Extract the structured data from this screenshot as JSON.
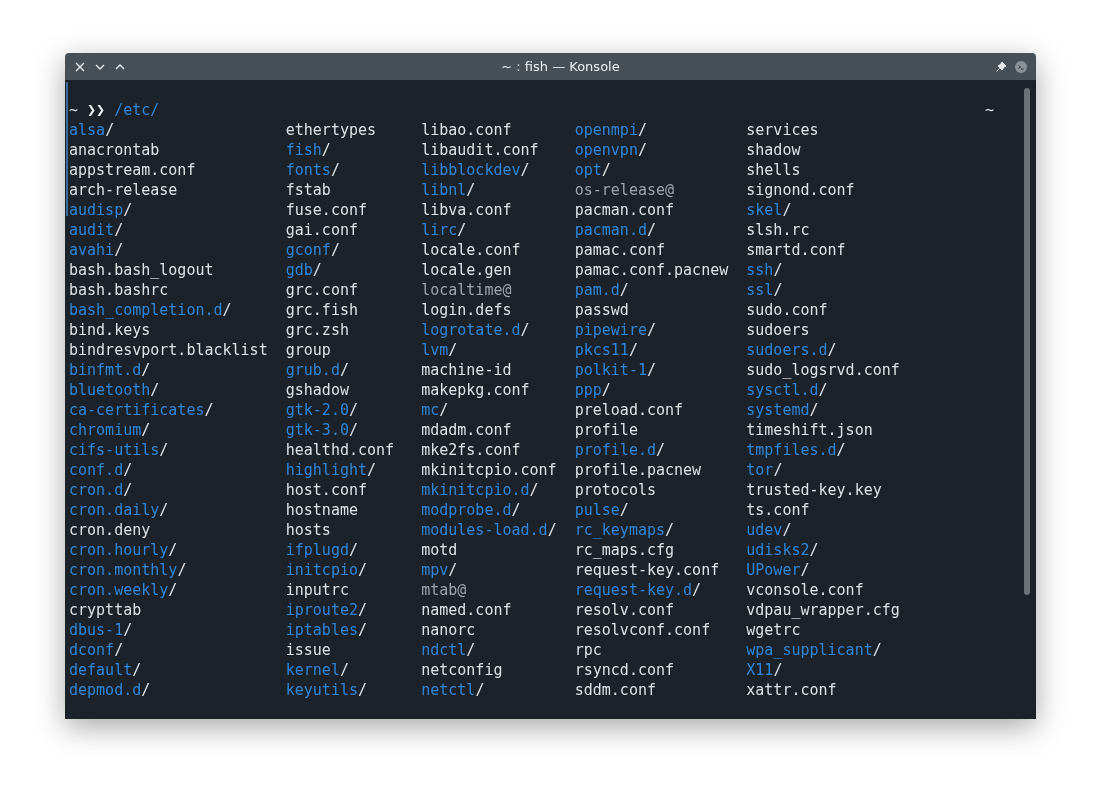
{
  "window": {
    "title": "~ : fish — Konsole"
  },
  "prompt": {
    "cwd": "~",
    "arrows": "❯❯",
    "command": "/etc/",
    "right_prompt": "~"
  },
  "columns": [
    [
      {
        "name": "alsa",
        "suffix": "/",
        "kind": "dir"
      },
      {
        "name": "anacrontab",
        "kind": "file"
      },
      {
        "name": "appstream.conf",
        "kind": "file"
      },
      {
        "name": "arch-release",
        "kind": "file"
      },
      {
        "name": "audisp",
        "suffix": "/",
        "kind": "dir"
      },
      {
        "name": "audit",
        "suffix": "/",
        "kind": "dir"
      },
      {
        "name": "avahi",
        "suffix": "/",
        "kind": "dir"
      },
      {
        "name": "bash.bash_logout",
        "kind": "file"
      },
      {
        "name": "bash.bashrc",
        "kind": "file"
      },
      {
        "name": "bash_completion.d",
        "suffix": "/",
        "kind": "dir"
      },
      {
        "name": "bind.keys",
        "kind": "file"
      },
      {
        "name": "bindresvport.blacklist",
        "kind": "file"
      },
      {
        "name": "binfmt.d",
        "suffix": "/",
        "kind": "dir"
      },
      {
        "name": "bluetooth",
        "suffix": "/",
        "kind": "dir"
      },
      {
        "name": "ca-certificates",
        "suffix": "/",
        "kind": "dir"
      },
      {
        "name": "chromium",
        "suffix": "/",
        "kind": "dir"
      },
      {
        "name": "cifs-utils",
        "suffix": "/",
        "kind": "dir"
      },
      {
        "name": "conf.d",
        "suffix": "/",
        "kind": "dir"
      },
      {
        "name": "cron.d",
        "suffix": "/",
        "kind": "dir"
      },
      {
        "name": "cron.daily",
        "suffix": "/",
        "kind": "dir"
      },
      {
        "name": "cron.deny",
        "kind": "file"
      },
      {
        "name": "cron.hourly",
        "suffix": "/",
        "kind": "dir"
      },
      {
        "name": "cron.monthly",
        "suffix": "/",
        "kind": "dir"
      },
      {
        "name": "cron.weekly",
        "suffix": "/",
        "kind": "dir"
      },
      {
        "name": "crypttab",
        "kind": "file"
      },
      {
        "name": "dbus-1",
        "suffix": "/",
        "kind": "dir"
      },
      {
        "name": "dconf",
        "suffix": "/",
        "kind": "dir"
      },
      {
        "name": "default",
        "suffix": "/",
        "kind": "dir"
      },
      {
        "name": "depmod.d",
        "suffix": "/",
        "kind": "dir"
      }
    ],
    [
      {
        "name": "ethertypes",
        "kind": "file"
      },
      {
        "name": "fish",
        "suffix": "/",
        "kind": "dir"
      },
      {
        "name": "fonts",
        "suffix": "/",
        "kind": "dir"
      },
      {
        "name": "fstab",
        "kind": "file"
      },
      {
        "name": "fuse.conf",
        "kind": "file"
      },
      {
        "name": "gai.conf",
        "kind": "file"
      },
      {
        "name": "gconf",
        "suffix": "/",
        "kind": "dir"
      },
      {
        "name": "gdb",
        "suffix": "/",
        "kind": "dir"
      },
      {
        "name": "grc.conf",
        "kind": "file"
      },
      {
        "name": "grc.fish",
        "kind": "file"
      },
      {
        "name": "grc.zsh",
        "kind": "file"
      },
      {
        "name": "group",
        "kind": "file"
      },
      {
        "name": "grub.d",
        "suffix": "/",
        "kind": "dir"
      },
      {
        "name": "gshadow",
        "kind": "file"
      },
      {
        "name": "gtk-2.0",
        "suffix": "/",
        "kind": "dir"
      },
      {
        "name": "gtk-3.0",
        "suffix": "/",
        "kind": "dir"
      },
      {
        "name": "healthd.conf",
        "kind": "file"
      },
      {
        "name": "highlight",
        "suffix": "/",
        "kind": "dir"
      },
      {
        "name": "host.conf",
        "kind": "file"
      },
      {
        "name": "hostname",
        "kind": "file"
      },
      {
        "name": "hosts",
        "kind": "file"
      },
      {
        "name": "ifplugd",
        "suffix": "/",
        "kind": "dir"
      },
      {
        "name": "initcpio",
        "suffix": "/",
        "kind": "dir"
      },
      {
        "name": "inputrc",
        "kind": "file"
      },
      {
        "name": "iproute2",
        "suffix": "/",
        "kind": "dir"
      },
      {
        "name": "iptables",
        "suffix": "/",
        "kind": "dir"
      },
      {
        "name": "issue",
        "kind": "file"
      },
      {
        "name": "kernel",
        "suffix": "/",
        "kind": "dir"
      },
      {
        "name": "keyutils",
        "suffix": "/",
        "kind": "dir"
      }
    ],
    [
      {
        "name": "libao.conf",
        "kind": "file"
      },
      {
        "name": "libaudit.conf",
        "kind": "file"
      },
      {
        "name": "libblockdev",
        "suffix": "/",
        "kind": "dir"
      },
      {
        "name": "libnl",
        "suffix": "/",
        "kind": "dir"
      },
      {
        "name": "libva.conf",
        "kind": "file"
      },
      {
        "name": "lirc",
        "suffix": "/",
        "kind": "dir"
      },
      {
        "name": "locale.conf",
        "kind": "file"
      },
      {
        "name": "locale.gen",
        "kind": "file"
      },
      {
        "name": "localtime",
        "suffix": "@",
        "kind": "link"
      },
      {
        "name": "login.defs",
        "kind": "file"
      },
      {
        "name": "logrotate.d",
        "suffix": "/",
        "kind": "dir"
      },
      {
        "name": "lvm",
        "suffix": "/",
        "kind": "dir"
      },
      {
        "name": "machine-id",
        "kind": "file"
      },
      {
        "name": "makepkg.conf",
        "kind": "file"
      },
      {
        "name": "mc",
        "suffix": "/",
        "kind": "dir"
      },
      {
        "name": "mdadm.conf",
        "kind": "file"
      },
      {
        "name": "mke2fs.conf",
        "kind": "file"
      },
      {
        "name": "mkinitcpio.conf",
        "kind": "file"
      },
      {
        "name": "mkinitcpio.d",
        "suffix": "/",
        "kind": "dir"
      },
      {
        "name": "modprobe.d",
        "suffix": "/",
        "kind": "dir"
      },
      {
        "name": "modules-load.d",
        "suffix": "/",
        "kind": "dir"
      },
      {
        "name": "motd",
        "kind": "file"
      },
      {
        "name": "mpv",
        "suffix": "/",
        "kind": "dir"
      },
      {
        "name": "mtab",
        "suffix": "@",
        "kind": "link"
      },
      {
        "name": "named.conf",
        "kind": "file"
      },
      {
        "name": "nanorc",
        "kind": "file"
      },
      {
        "name": "ndctl",
        "suffix": "/",
        "kind": "dir"
      },
      {
        "name": "netconfig",
        "kind": "file"
      },
      {
        "name": "netctl",
        "suffix": "/",
        "kind": "dir"
      }
    ],
    [
      {
        "name": "openmpi",
        "suffix": "/",
        "kind": "dir"
      },
      {
        "name": "openvpn",
        "suffix": "/",
        "kind": "dir"
      },
      {
        "name": "opt",
        "suffix": "/",
        "kind": "dir"
      },
      {
        "name": "os-release",
        "suffix": "@",
        "kind": "link"
      },
      {
        "name": "pacman.conf",
        "kind": "file"
      },
      {
        "name": "pacman.d",
        "suffix": "/",
        "kind": "dir"
      },
      {
        "name": "pamac.conf",
        "kind": "file"
      },
      {
        "name": "pamac.conf.pacnew",
        "kind": "file"
      },
      {
        "name": "pam.d",
        "suffix": "/",
        "kind": "dir"
      },
      {
        "name": "passwd",
        "kind": "file"
      },
      {
        "name": "pipewire",
        "suffix": "/",
        "kind": "dir"
      },
      {
        "name": "pkcs11",
        "suffix": "/",
        "kind": "dir"
      },
      {
        "name": "polkit-1",
        "suffix": "/",
        "kind": "dir"
      },
      {
        "name": "ppp",
        "suffix": "/",
        "kind": "dir"
      },
      {
        "name": "preload.conf",
        "kind": "file"
      },
      {
        "name": "profile",
        "kind": "file"
      },
      {
        "name": "profile.d",
        "suffix": "/",
        "kind": "dir"
      },
      {
        "name": "profile.pacnew",
        "kind": "file"
      },
      {
        "name": "protocols",
        "kind": "file"
      },
      {
        "name": "pulse",
        "suffix": "/",
        "kind": "dir"
      },
      {
        "name": "rc_keymaps",
        "suffix": "/",
        "kind": "dir"
      },
      {
        "name": "rc_maps.cfg",
        "kind": "file"
      },
      {
        "name": "request-key.conf",
        "kind": "file"
      },
      {
        "name": "request-key.d",
        "suffix": "/",
        "kind": "dir"
      },
      {
        "name": "resolv.conf",
        "kind": "file"
      },
      {
        "name": "resolvconf.conf",
        "kind": "file"
      },
      {
        "name": "rpc",
        "kind": "file"
      },
      {
        "name": "rsyncd.conf",
        "kind": "file"
      },
      {
        "name": "sddm.conf",
        "kind": "file"
      }
    ],
    [
      {
        "name": "services",
        "kind": "file"
      },
      {
        "name": "shadow",
        "kind": "file"
      },
      {
        "name": "shells",
        "kind": "file"
      },
      {
        "name": "signond.conf",
        "kind": "file"
      },
      {
        "name": "skel",
        "suffix": "/",
        "kind": "dir"
      },
      {
        "name": "slsh.rc",
        "kind": "file"
      },
      {
        "name": "smartd.conf",
        "kind": "file"
      },
      {
        "name": "ssh",
        "suffix": "/",
        "kind": "dir"
      },
      {
        "name": "ssl",
        "suffix": "/",
        "kind": "dir"
      },
      {
        "name": "sudo.conf",
        "kind": "file"
      },
      {
        "name": "sudoers",
        "kind": "file"
      },
      {
        "name": "sudoers.d",
        "suffix": "/",
        "kind": "dir"
      },
      {
        "name": "sudo_logsrvd.conf",
        "kind": "file"
      },
      {
        "name": "sysctl.d",
        "suffix": "/",
        "kind": "dir"
      },
      {
        "name": "systemd",
        "suffix": "/",
        "kind": "dir"
      },
      {
        "name": "timeshift.json",
        "kind": "file"
      },
      {
        "name": "tmpfiles.d",
        "suffix": "/",
        "kind": "dir"
      },
      {
        "name": "tor",
        "suffix": "/",
        "kind": "dir"
      },
      {
        "name": "trusted-key.key",
        "kind": "file"
      },
      {
        "name": "ts.conf",
        "kind": "file"
      },
      {
        "name": "udev",
        "suffix": "/",
        "kind": "dir"
      },
      {
        "name": "udisks2",
        "suffix": "/",
        "kind": "dir"
      },
      {
        "name": "UPower",
        "suffix": "/",
        "kind": "dir"
      },
      {
        "name": "vconsole.conf",
        "kind": "file"
      },
      {
        "name": "vdpau_wrapper.cfg",
        "kind": "file"
      },
      {
        "name": "wgetrc",
        "kind": "file"
      },
      {
        "name": "wpa_supplicant",
        "suffix": "/",
        "kind": "dir"
      },
      {
        "name": "X11",
        "suffix": "/",
        "kind": "dir"
      },
      {
        "name": "xattr.conf",
        "kind": "file"
      }
    ]
  ]
}
